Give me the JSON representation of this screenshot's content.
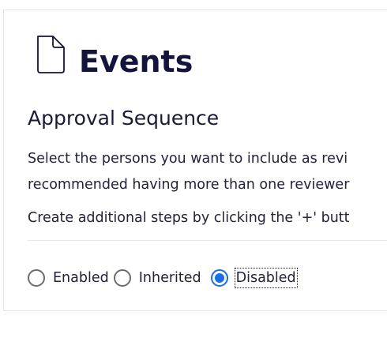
{
  "header": {
    "icon": "document-icon",
    "title": "Events"
  },
  "approval": {
    "section_title": "Approval Sequence",
    "description_line1": "Select the persons you want to include as revi",
    "description_line2": "recommended having more than one reviewer",
    "description_line3": "Create additional steps by clicking the '+' butt"
  },
  "approval_mode": {
    "options": [
      {
        "label": "Enabled",
        "checked": false
      },
      {
        "label": "Inherited",
        "checked": false
      },
      {
        "label": "Disabled",
        "checked": true
      }
    ],
    "selected": "Disabled"
  },
  "colors": {
    "title": "#14143c",
    "accent": "#1a6ee6",
    "radio_border": "#6b6b75",
    "card_border": "#e4e4ea"
  }
}
